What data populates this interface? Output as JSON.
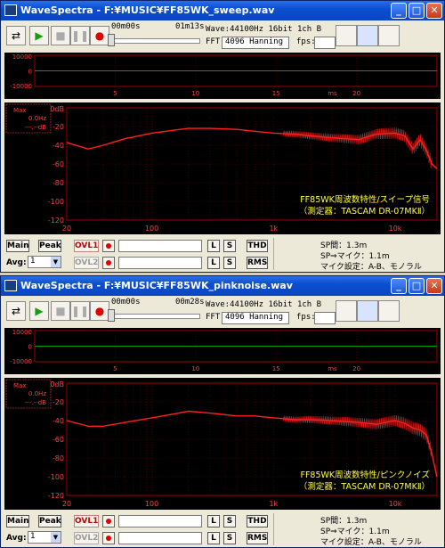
{
  "colors": {
    "accent": "#0a46c0",
    "curve": "#ff2020",
    "grid": "#a00000",
    "scope_line": "#00a000",
    "caption": "#ffff40"
  },
  "windows": [
    {
      "title": "WaveSpectra - F:¥MUSIC¥FF85WK_sweep.wav",
      "time_start": "00m00s",
      "time_end": "01m13s",
      "wave_info": "Wave:44100Hz 16bit 1ch B",
      "fft_label": "FFT:",
      "fft_value": "4096 Hanning",
      "fps_label": "fps:",
      "scope": {
        "yticks": [
          "10000",
          "0",
          "-10000"
        ],
        "xticks": [
          "5",
          "10",
          "15",
          "20"
        ],
        "unit": "ms"
      },
      "spectrum": {
        "max_label": "Max",
        "max_freq": "0.0Hz",
        "max_db": "---.--dB",
        "y_unit": "0dB",
        "yticks": [
          "-20",
          "-40",
          "-60",
          "-80",
          "-100",
          "-120"
        ],
        "xticks": [
          "20",
          "100",
          "1k",
          "10k"
        ],
        "caption1": "FF85WK周波数特性/スイープ信号",
        "caption2": "（測定器：TASCAM DR-07MKⅡ）"
      },
      "chart_data": {
        "type": "line",
        "x_scale": "log",
        "xlim": [
          20,
          22050
        ],
        "ylim": [
          -120,
          0
        ],
        "xlabel": "Hz",
        "ylabel": "dB",
        "x": [
          20,
          30,
          40,
          60,
          100,
          150,
          200,
          300,
          500,
          700,
          1000,
          1500,
          2000,
          3000,
          5000,
          7000,
          10000,
          12000,
          14000,
          16000,
          18000,
          20000,
          22000
        ],
        "y": [
          -37,
          -44,
          -40,
          -33,
          -27,
          -24,
          -22,
          -22,
          -23,
          -25,
          -27,
          -28,
          -30,
          -32,
          -34,
          -28,
          -27,
          -30,
          -44,
          -34,
          -45,
          -60,
          -65
        ]
      },
      "bottom": {
        "main": "Main",
        "peak": "Peak",
        "ovl1": "OVL1",
        "ovl2": "OVL2",
        "avg_label": "Avg:",
        "avg_value": "1",
        "l": "L",
        "s": "S",
        "thd": "THD",
        "rms": "RMS",
        "info1": "SP間：1.3m",
        "info2": "SP⇒マイク：1.1m",
        "info3": "マイク設定：A-B、モノラル"
      }
    },
    {
      "title": "WaveSpectra - F:¥MUSIC¥FF85WK_pinknoise.wav",
      "time_start": "00m00s",
      "time_end": "00m28s",
      "wave_info": "Wave:44100Hz 16bit 1ch B",
      "fft_label": "FFT:",
      "fft_value": "4096 Hanning",
      "fps_label": "fps:",
      "scope": {
        "yticks": [
          "10000",
          "0",
          "-10000"
        ],
        "xticks": [
          "5",
          "10",
          "15",
          "20"
        ],
        "unit": "ms"
      },
      "spectrum": {
        "max_label": "Max",
        "max_freq": "0.0Hz",
        "max_db": "---.--dB",
        "y_unit": "0dB",
        "yticks": [
          "-20",
          "-40",
          "-60",
          "-80",
          "-100",
          "-120"
        ],
        "xticks": [
          "20",
          "100",
          "1k",
          "10k"
        ],
        "caption1": "FF85WK周波数特性/ピンクノイズ",
        "caption2": "（測定器：TASCAM DR-07MKⅡ）"
      },
      "chart_data": {
        "type": "line",
        "x_scale": "log",
        "xlim": [
          20,
          22050
        ],
        "ylim": [
          -120,
          0
        ],
        "xlabel": "Hz",
        "ylabel": "dB",
        "x": [
          20,
          30,
          40,
          60,
          100,
          150,
          200,
          300,
          500,
          700,
          1000,
          1500,
          2000,
          3000,
          5000,
          7000,
          10000,
          12000,
          14000,
          16000,
          18000,
          20000,
          22000
        ],
        "y": [
          -40,
          -46,
          -46,
          -42,
          -37,
          -33,
          -30,
          -32,
          -35,
          -35,
          -37,
          -39,
          -39,
          -40,
          -42,
          -44,
          -40,
          -43,
          -48,
          -50,
          -55,
          -75,
          -100
        ]
      },
      "bottom": {
        "main": "Main",
        "peak": "Peak",
        "ovl1": "OVL1",
        "ovl2": "OVL2",
        "avg_label": "Avg:",
        "avg_value": "1",
        "l": "L",
        "s": "S",
        "thd": "THD",
        "rms": "RMS",
        "info1": "SP間：1.3m",
        "info2": "SP⇒マイク：1.1m",
        "info3": "マイク設定：A-B、モノラル"
      }
    }
  ]
}
